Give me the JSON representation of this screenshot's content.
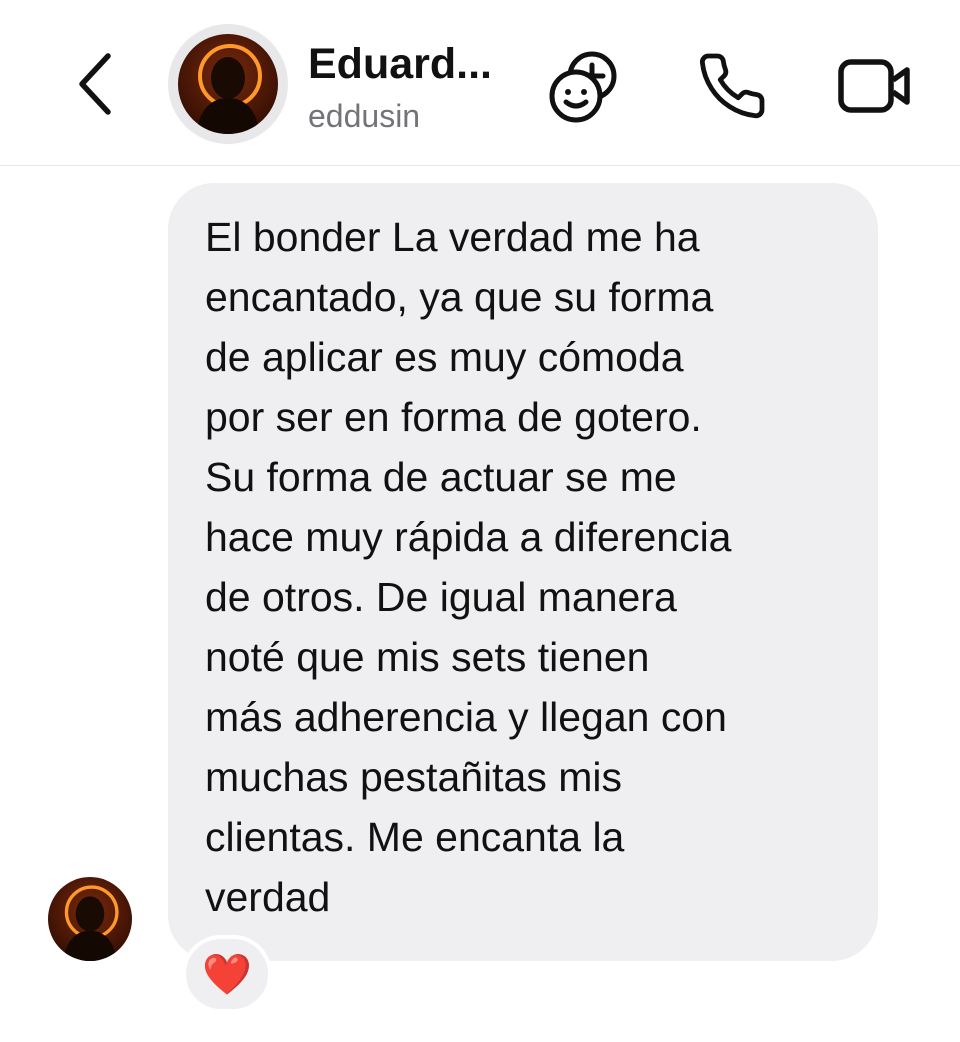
{
  "header": {
    "contact_name": "Eduard...",
    "contact_handle": "eddusin",
    "icons": {
      "back": "chevron-left-icon",
      "add_friend": "add-people-icon",
      "call": "phone-icon",
      "video": "video-camera-icon"
    }
  },
  "message": {
    "text": "El bonder La verdad me ha\nencantado, ya que su forma\nde aplicar es muy cómoda\npor ser en forma de gotero.\nSu forma de actuar se me\nhace muy rápida a diferencia\nde otros. De igual manera\nnoté que mis sets tienen\nmás adherencia y llegan con\nmuchas pestañitas mis\nclientas. Me encanta la\nverdad",
    "reaction": "❤️"
  },
  "colors": {
    "bubble": "#efeff2",
    "text": "#111111",
    "secondary_text": "#737378",
    "avatar_ring": "#ff8a1c",
    "heart": "#ff2d3b"
  }
}
